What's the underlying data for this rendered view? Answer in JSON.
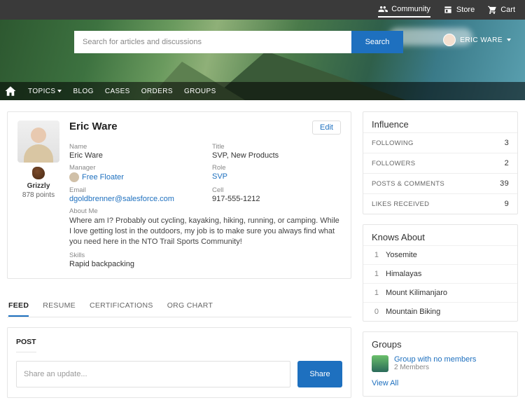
{
  "topbar": {
    "community": "Community",
    "store": "Store",
    "cart": "Cart"
  },
  "search": {
    "placeholder": "Search for articles and discussions",
    "button": "Search"
  },
  "user": {
    "name": "ERIC WARE"
  },
  "nav": {
    "topics": "TOPICS",
    "blog": "BLOG",
    "cases": "CASES",
    "orders": "ORDERS",
    "groups": "GROUPS"
  },
  "profile": {
    "display_name": "Eric Ware",
    "edit": "Edit",
    "badge_label": "Grizzly",
    "points": "878 points",
    "labels": {
      "name": "Name",
      "title": "Title",
      "manager": "Manager",
      "role": "Role",
      "email": "Email",
      "cell": "Cell",
      "about_me": "About Me",
      "skills": "Skills"
    },
    "values": {
      "name": "Eric Ware",
      "title": "SVP, New Products",
      "manager": "Free Floater",
      "role": "SVP",
      "email": "dgoldbrenner@salesforce.com",
      "cell": "917-555-1212",
      "about_me": "Where am I? Probably out cycling, kayaking, hiking, running, or camping. While I love getting lost in the outdoors, my job is to make sure you always find what you need here in the NTO Trail Sports Community!",
      "skills": "Rapid backpacking"
    }
  },
  "tabs": {
    "feed": "FEED",
    "resume": "RESUME",
    "certs": "CERTIFICATIONS",
    "org": "ORG CHART"
  },
  "post": {
    "tab": "POST",
    "placeholder": "Share an update...",
    "button": "Share"
  },
  "influence": {
    "title": "Influence",
    "rows": [
      {
        "label": "FOLLOWING",
        "value": "3"
      },
      {
        "label": "FOLLOWERS",
        "value": "2"
      },
      {
        "label": "POSTS & COMMENTS",
        "value": "39"
      },
      {
        "label": "LIKES RECEIVED",
        "value": "9"
      }
    ]
  },
  "knows": {
    "title": "Knows About",
    "rows": [
      {
        "count": "1",
        "label": "Yosemite"
      },
      {
        "count": "1",
        "label": "Himalayas"
      },
      {
        "count": "1",
        "label": "Mount Kilimanjaro"
      },
      {
        "count": "0",
        "label": "Mountain Biking"
      }
    ]
  },
  "groups": {
    "title": "Groups",
    "item_name": "Group with no members",
    "item_sub": "2 Members",
    "view_all": "View All"
  }
}
